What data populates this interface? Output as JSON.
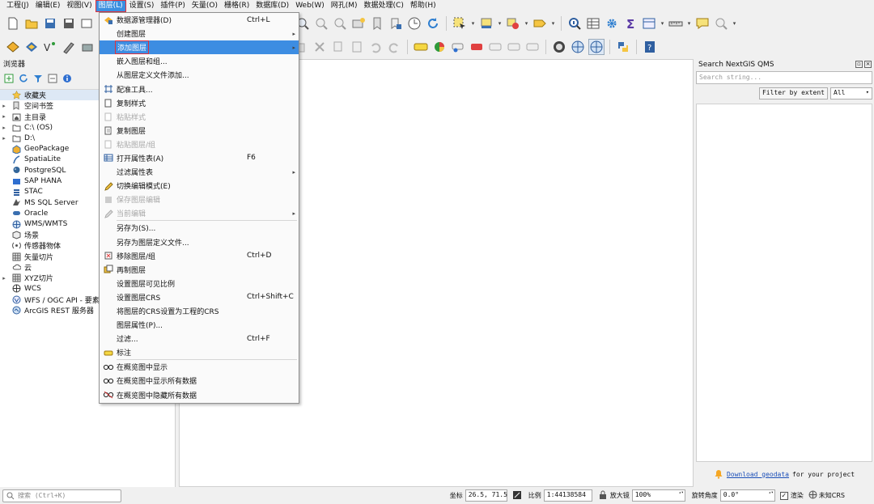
{
  "menubar": [
    {
      "label": "工程(J)"
    },
    {
      "label": "编辑(E)"
    },
    {
      "label": "视图(V)"
    },
    {
      "label": "图层(L)",
      "active": true
    },
    {
      "label": "设置(S)"
    },
    {
      "label": "插件(P)"
    },
    {
      "label": "矢量(O)"
    },
    {
      "label": "栅格(R)"
    },
    {
      "label": "数据库(D)"
    },
    {
      "label": "Web(W)"
    },
    {
      "label": "网孔(M)"
    },
    {
      "label": "数据处理(C)"
    },
    {
      "label": "帮助(H)"
    }
  ],
  "layer_menu": {
    "items": [
      {
        "label": "数据源管理器(D)",
        "shortcut": "Ctrl+L",
        "icon": "data-source-manager-icon"
      },
      {
        "label": "创建图层",
        "submenu": true
      },
      {
        "label": "添加图层",
        "submenu": true,
        "highlighted": true
      },
      {
        "label": "嵌入图层和组..."
      },
      {
        "label": "从图层定义文件添加..."
      },
      {
        "label": "配准工具...",
        "icon": "georeferencer-icon"
      },
      {
        "label": "复制样式",
        "icon": "copy-style-icon"
      },
      {
        "label": "粘贴样式",
        "disabled": true,
        "icon": "paste-style-icon"
      },
      {
        "label": "复制图层",
        "icon": "copy-layer-icon"
      },
      {
        "label": "粘贴图层/组",
        "disabled": true,
        "icon": "paste-layer-icon"
      },
      {
        "label": "打开属性表(A)",
        "shortcut": "F6",
        "icon": "attribute-table-icon"
      },
      {
        "label": "过滤属性表",
        "submenu": true
      },
      {
        "label": "切换编辑模式(E)",
        "icon": "pencil-icon"
      },
      {
        "label": "保存图层编辑",
        "disabled": true,
        "icon": "save-edits-icon"
      },
      {
        "label": "当前编辑",
        "disabled": true,
        "submenu": true,
        "icon": "current-edits-icon"
      },
      {
        "sep": true
      },
      {
        "label": "另存为(S)..."
      },
      {
        "label": "另存为图层定义文件..."
      },
      {
        "label": "移除图层/组",
        "shortcut": "Ctrl+D",
        "icon": "remove-layer-icon"
      },
      {
        "label": "再制图层",
        "icon": "duplicate-layer-icon"
      },
      {
        "label": "设置图层可见比例"
      },
      {
        "label": "设置图层CRS",
        "shortcut": "Ctrl+Shift+C"
      },
      {
        "label": "将图层的CRS设置为工程的CRS"
      },
      {
        "label": "图层属性(P)..."
      },
      {
        "label": "过滤...",
        "shortcut": "Ctrl+F"
      },
      {
        "label": "标注",
        "icon": "label-icon"
      },
      {
        "sep": true
      },
      {
        "label": "在概览图中显示",
        "icon": "overview-show-icon"
      },
      {
        "label": "在概览图中显示所有数据",
        "icon": "overview-show-all-icon"
      },
      {
        "label": "在概览图中隐藏所有数据",
        "icon": "overview-hide-all-icon"
      }
    ]
  },
  "browser": {
    "title": "浏览器",
    "items": [
      {
        "label": "收藏夹",
        "icon": "star-icon",
        "expand": false,
        "selected": true
      },
      {
        "label": "空间书签",
        "icon": "bookmark-icon",
        "expand": true
      },
      {
        "label": "主目录",
        "icon": "home-folder-icon",
        "expand": true
      },
      {
        "label": "C:\\ (OS)",
        "icon": "folder-icon",
        "expand": true
      },
      {
        "label": "D:\\",
        "icon": "folder-icon",
        "expand": true
      },
      {
        "label": "GeoPackage",
        "icon": "geopackage-icon",
        "expand": false
      },
      {
        "label": "SpatiaLite",
        "icon": "spatialite-icon",
        "expand": false
      },
      {
        "label": "PostgreSQL",
        "icon": "postgresql-icon",
        "expand": false
      },
      {
        "label": "SAP HANA",
        "icon": "sap-hana-icon",
        "expand": false
      },
      {
        "label": "STAC",
        "icon": "stac-icon",
        "expand": false
      },
      {
        "label": "MS SQL Server",
        "icon": "mssql-icon",
        "expand": false
      },
      {
        "label": "Oracle",
        "icon": "oracle-icon",
        "expand": false
      },
      {
        "label": "WMS/WMTS",
        "icon": "wms-icon",
        "expand": false
      },
      {
        "label": "场景",
        "icon": "scene-icon",
        "expand": false
      },
      {
        "label": "传感器物体",
        "icon": "sensor-icon",
        "expand": false
      },
      {
        "label": "矢量切片",
        "icon": "vector-tile-icon",
        "expand": false
      },
      {
        "label": "云",
        "icon": "cloud-icon",
        "expand": false
      },
      {
        "label": "XYZ切片",
        "icon": "xyz-tile-icon",
        "expand": true
      },
      {
        "label": "WCS",
        "icon": "wcs-icon",
        "expand": false
      },
      {
        "label": "WFS / OGC API - 要素",
        "icon": "wfs-icon",
        "expand": false
      },
      {
        "label": "ArcGIS REST 服务器",
        "icon": "arcgis-icon",
        "expand": false
      }
    ]
  },
  "qms": {
    "title": "Search NextGIS QMS",
    "search_placeholder": "Search string...",
    "filter_button": "Filter by extent",
    "filter_select": "All",
    "footer_link": "Download geodata",
    "footer_text": "for your project"
  },
  "status": {
    "search_placeholder": "搜索 (Ctrl+K)",
    "coord_label": "坐标",
    "coord_value": "26.5, 71.5",
    "scale_label": "比例",
    "scale_value": "1:44138584",
    "magnifier_label": "放大镜",
    "magnifier_value": "100%",
    "rotation_label": "旋转角度",
    "rotation_value": "0.0°",
    "render_label": "渲染",
    "crs_label": "未知CRS"
  },
  "colors": {
    "highlight": "#3d8de2",
    "highlight_border": "#e0313b"
  }
}
